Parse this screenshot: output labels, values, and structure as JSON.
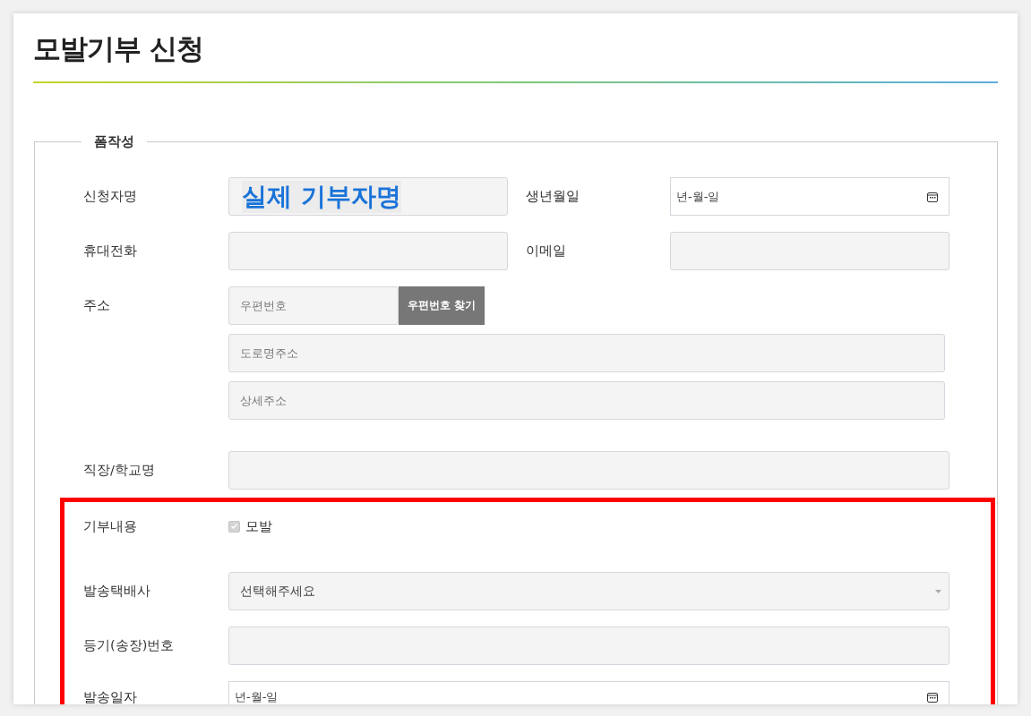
{
  "title": "모발기부 신청",
  "form": {
    "legend": "폼작성",
    "sections": [
      {
        "highlighted": false,
        "rows": [
          {
            "kind": "pair",
            "fields": [
              {
                "label": "신청자명",
                "kind": "text",
                "value": "실제 기부자명"
              },
              {
                "label": "생년월일",
                "kind": "date",
                "placeholder": "년-월-일"
              }
            ]
          },
          {
            "kind": "pair",
            "fields": [
              {
                "label": "휴대전화",
                "kind": "text"
              },
              {
                "label": "이메일",
                "kind": "text"
              }
            ]
          },
          {
            "kind": "address",
            "label": "주소",
            "postal_placeholder": "우편번호",
            "button": "우편번호 찾기",
            "road_placeholder": "도로명주소",
            "detail_placeholder": "상세주소"
          },
          {
            "kind": "wide",
            "label": "직장/학교명",
            "field": {
              "kind": "text"
            }
          }
        ]
      },
      {
        "highlighted": true,
        "rows": [
          {
            "kind": "checkbox",
            "label": "기부내용",
            "option": "모발",
            "checked": true,
            "disabled": true
          },
          {
            "kind": "wide",
            "label": "발송택배사",
            "field": {
              "kind": "select",
              "value": "선택해주세요"
            }
          },
          {
            "kind": "wide",
            "label": "등기(송장)번호",
            "field": {
              "kind": "text"
            }
          },
          {
            "kind": "wide",
            "label": "발송일자",
            "field": {
              "kind": "date",
              "placeholder": "년-월-일"
            }
          }
        ]
      }
    ]
  }
}
